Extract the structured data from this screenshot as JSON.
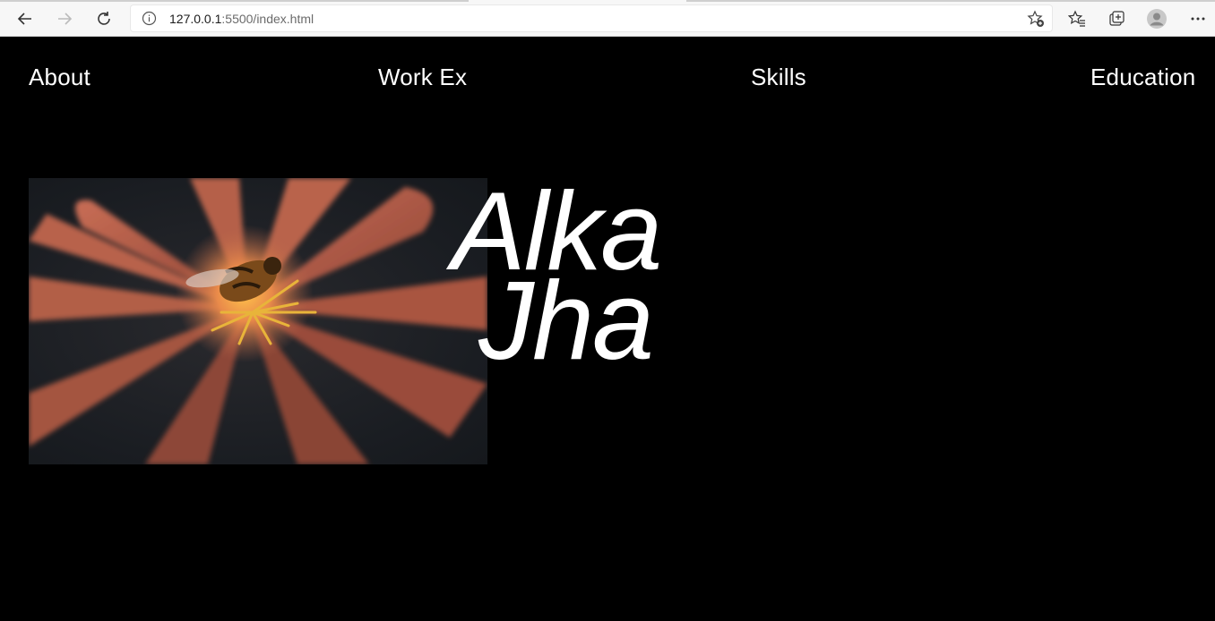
{
  "browser": {
    "url_host": "127.0.0.1",
    "url_rest": ":5500/index.html",
    "icons": [
      "back-arrow-icon",
      "forward-arrow-icon",
      "refresh-icon",
      "info-icon",
      "add-favorite-icon",
      "favorites-icon",
      "collections-icon",
      "profile-icon",
      "more-icon"
    ]
  },
  "nav": {
    "about": "About",
    "work": "Work Ex",
    "skills": "Skills",
    "education": "Education"
  },
  "hero": {
    "first_name": "Alka",
    "last_name": "Jha"
  },
  "colors": {
    "background": "#000000",
    "text": "#ffffff",
    "petal": "#b0604a"
  }
}
